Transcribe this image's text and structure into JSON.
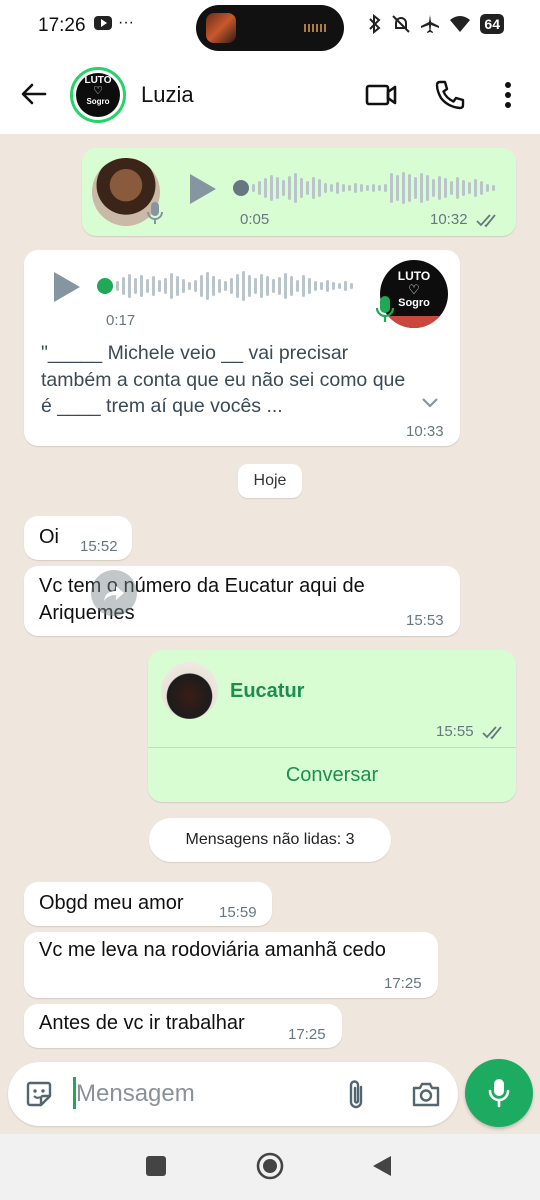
{
  "status_bar": {
    "time": "17:26",
    "extra": "···",
    "battery": "64"
  },
  "header": {
    "contact_name": "Luzia",
    "avatar": {
      "line1": "LUTO",
      "line2": "Sogro"
    }
  },
  "messages": {
    "m1": {
      "duration": "0:05",
      "time": "10:32"
    },
    "m2": {
      "duration": "0:17",
      "transcript": "\"_____ Michele veio __ vai precisar também a conta que eu não sei como que é ____ trem aí que vocês ...",
      "time": "10:33",
      "avatar_line1": "LUTO",
      "avatar_line2": "Sogro"
    },
    "day_separator": "Hoje",
    "m3": {
      "text": "Oi",
      "time": "15:52"
    },
    "m4": {
      "text": "Vc tem o número da Eucatur aqui de Ariquemes",
      "time": "15:53"
    },
    "m5": {
      "contact_name": "Eucatur",
      "time": "15:55",
      "action": "Conversar"
    },
    "unread_label": "Mensagens não lidas: 3",
    "m6": {
      "text": "Obgd meu amor",
      "time": "15:59"
    },
    "m7": {
      "text": "Vc me leva na rodoviária amanhã cedo",
      "time": "17:25"
    },
    "m8": {
      "text": "Antes de vc ir trabalhar",
      "time": "17:25"
    }
  },
  "composer": {
    "placeholder": "Mensagem"
  },
  "colors": {
    "outgoing_bubble": "#d9fdd3",
    "incoming_bubble": "#ffffff",
    "accent_green": "#1daa61",
    "chat_background": "#efe7de"
  },
  "icons": [
    "back-arrow-icon",
    "video-call-icon",
    "phone-icon",
    "more-vert-icon",
    "play-icon",
    "mic-icon",
    "chevron-down-icon",
    "double-check-icon",
    "forward-icon",
    "sticker-icon",
    "attach-icon",
    "camera-icon",
    "nav-recents-icon",
    "nav-home-icon",
    "nav-back-icon"
  ]
}
